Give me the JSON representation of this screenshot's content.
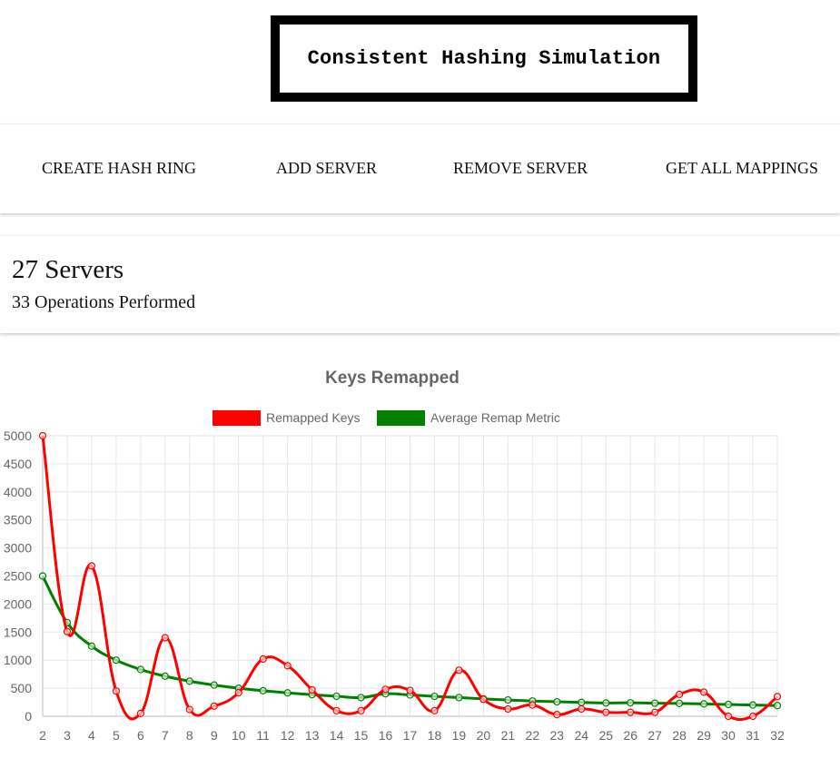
{
  "header": {
    "title": "Consistent Hashing Simulation"
  },
  "nav": {
    "create_label": "CREATE HASH RING",
    "add_label": "ADD SERVER",
    "remove_label": "REMOVE SERVER",
    "mappings_label": "GET ALL MAPPINGS"
  },
  "stats": {
    "servers": "27 Servers",
    "operations": "33 Operations Performed"
  },
  "chart_data": {
    "type": "line",
    "title": "Keys Remapped",
    "xlabel": "",
    "ylabel": "",
    "x": [
      2,
      3,
      4,
      5,
      6,
      7,
      8,
      9,
      10,
      11,
      12,
      13,
      14,
      15,
      16,
      17,
      18,
      19,
      20,
      21,
      22,
      23,
      24,
      25,
      26,
      27,
      28,
      29,
      30,
      31,
      32
    ],
    "ylim": [
      0,
      5000
    ],
    "yticks": [
      0,
      500,
      1000,
      1500,
      2000,
      2500,
      3000,
      3500,
      4000,
      4500,
      5000
    ],
    "grid": true,
    "legend_position": "top",
    "series": [
      {
        "name": "Remapped Keys",
        "color": "#ff0000",
        "values": [
          5000,
          1510,
          2680,
          450,
          50,
          1400,
          120,
          180,
          420,
          1020,
          900,
          470,
          100,
          100,
          480,
          460,
          100,
          820,
          300,
          130,
          200,
          30,
          130,
          70,
          70,
          70,
          390,
          430,
          0,
          0,
          350
        ]
      },
      {
        "name": "Average Remap Metric",
        "color": "#008000",
        "values": [
          2500,
          1670,
          1250,
          1000,
          833,
          714,
          625,
          556,
          500,
          455,
          417,
          385,
          357,
          333,
          400,
          380,
          355,
          333,
          310,
          290,
          272,
          258,
          247,
          237,
          240,
          233,
          228,
          220,
          210,
          200,
          190
        ]
      }
    ]
  }
}
